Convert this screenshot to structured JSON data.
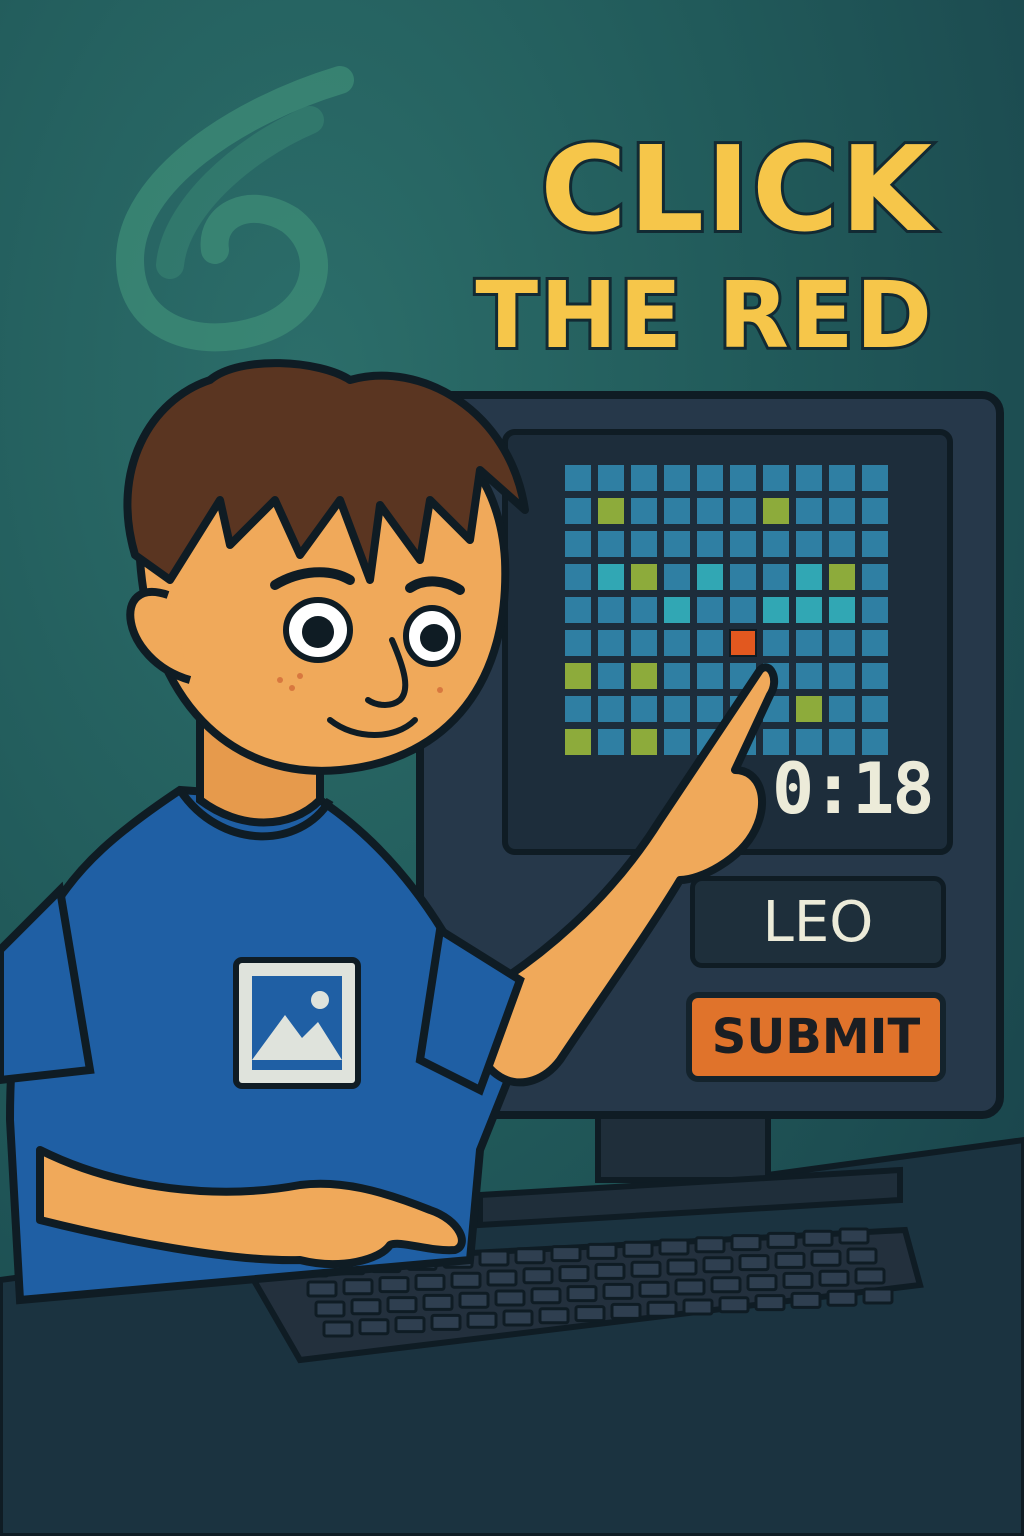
{
  "title": {
    "line1": "CLICK",
    "line2": "THE RED"
  },
  "game": {
    "timer": "0:18",
    "grid": {
      "cols": 10,
      "rows": 9,
      "target": {
        "row": 5,
        "col": 5
      },
      "cells": [
        "BBBBBBBBBB",
        "BGBBBBGBBB",
        "BBBBBBBBBB",
        "BTGBTBBTGB",
        "BBBTBBTTTB",
        "BBBBBRBBBB",
        "GBGBBBBBBB",
        "BBBBBBBGBB",
        "GBGBBBBBBB"
      ]
    },
    "name_field": {
      "value": "LEO",
      "placeholder": ""
    },
    "submit_label": "SUBMIT"
  },
  "colors": {
    "cell_blue": "#2f7fa3",
    "cell_teal": "#31a7b4",
    "cell_green": "#8dab3b",
    "cell_red": "#e2581f",
    "title": "#f6c64a",
    "button": "#e0732b",
    "shirt": "#1f5fa4",
    "skin": "#f0a95a",
    "hair": "#5a3521"
  },
  "shirt_icon": "image-icon"
}
